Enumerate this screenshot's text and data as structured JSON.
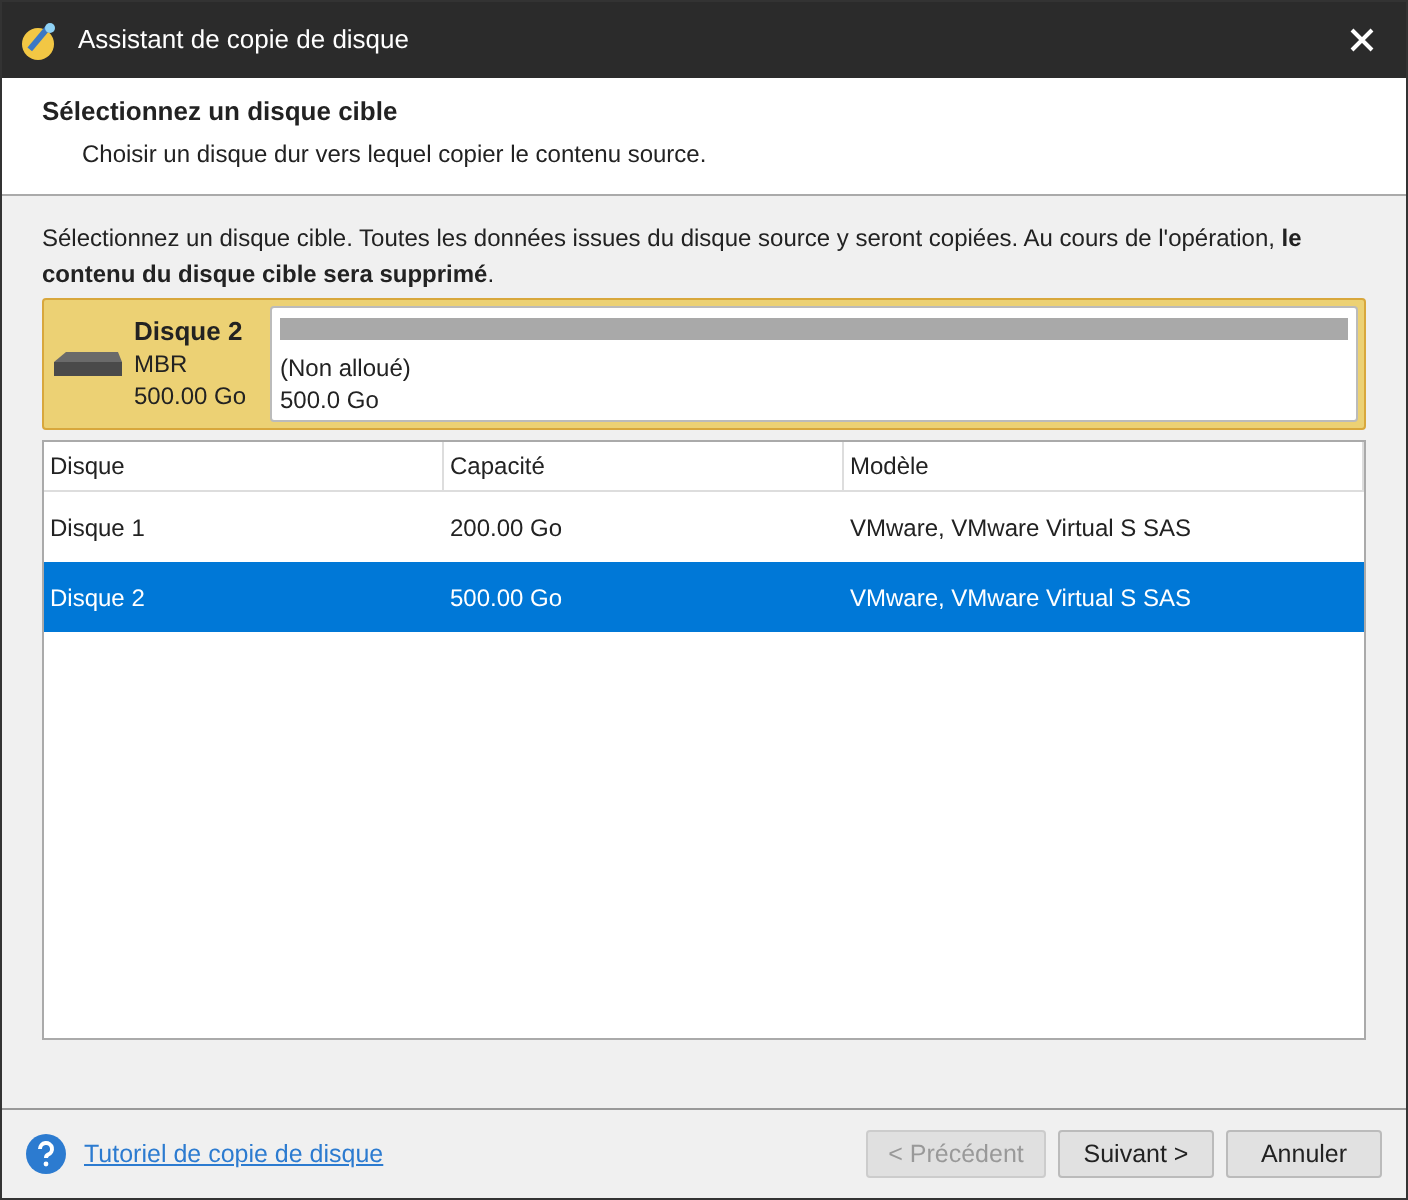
{
  "window": {
    "title": "Assistant de copie de disque"
  },
  "header": {
    "title": "Sélectionnez un disque cible",
    "subtitle": "Choisir un disque dur vers lequel copier le contenu source."
  },
  "instructions": "Sélectionnez un disque cible. Toutes les données issues du disque source y seront copiées. Au cours de l'opération, **le contenu du disque cible sera supprimé**.",
  "disk_card": {
    "name": "Disque 2",
    "type": "MBR",
    "size": "500.00 Go",
    "partition_label": "(Non alloué)",
    "partition_size": "500.0 Go",
    "level": 1
  },
  "table": {
    "columns": [
      "Disque",
      "Capacité",
      "Modèle"
    ],
    "rows": [
      {
        "cells": [
          "Disque 1",
          "200.00 Go",
          "VMware, VMware Virtual S SAS"
        ],
        "selected": false
      },
      {
        "cells": [
          "Disque 2",
          "500.00 Go",
          "VMware, VMware Virtual S SAS"
        ],
        "selected": true
      }
    ]
  },
  "footer": {
    "help_link": "Tutoriel de copie de disque",
    "buttons": [
      {
        "label": "< Précédent",
        "disabled": true
      },
      {
        "label": "Suivant >",
        "disabled": false
      },
      {
        "label": "Annuler",
        "disabled": false
      }
    ]
  }
}
